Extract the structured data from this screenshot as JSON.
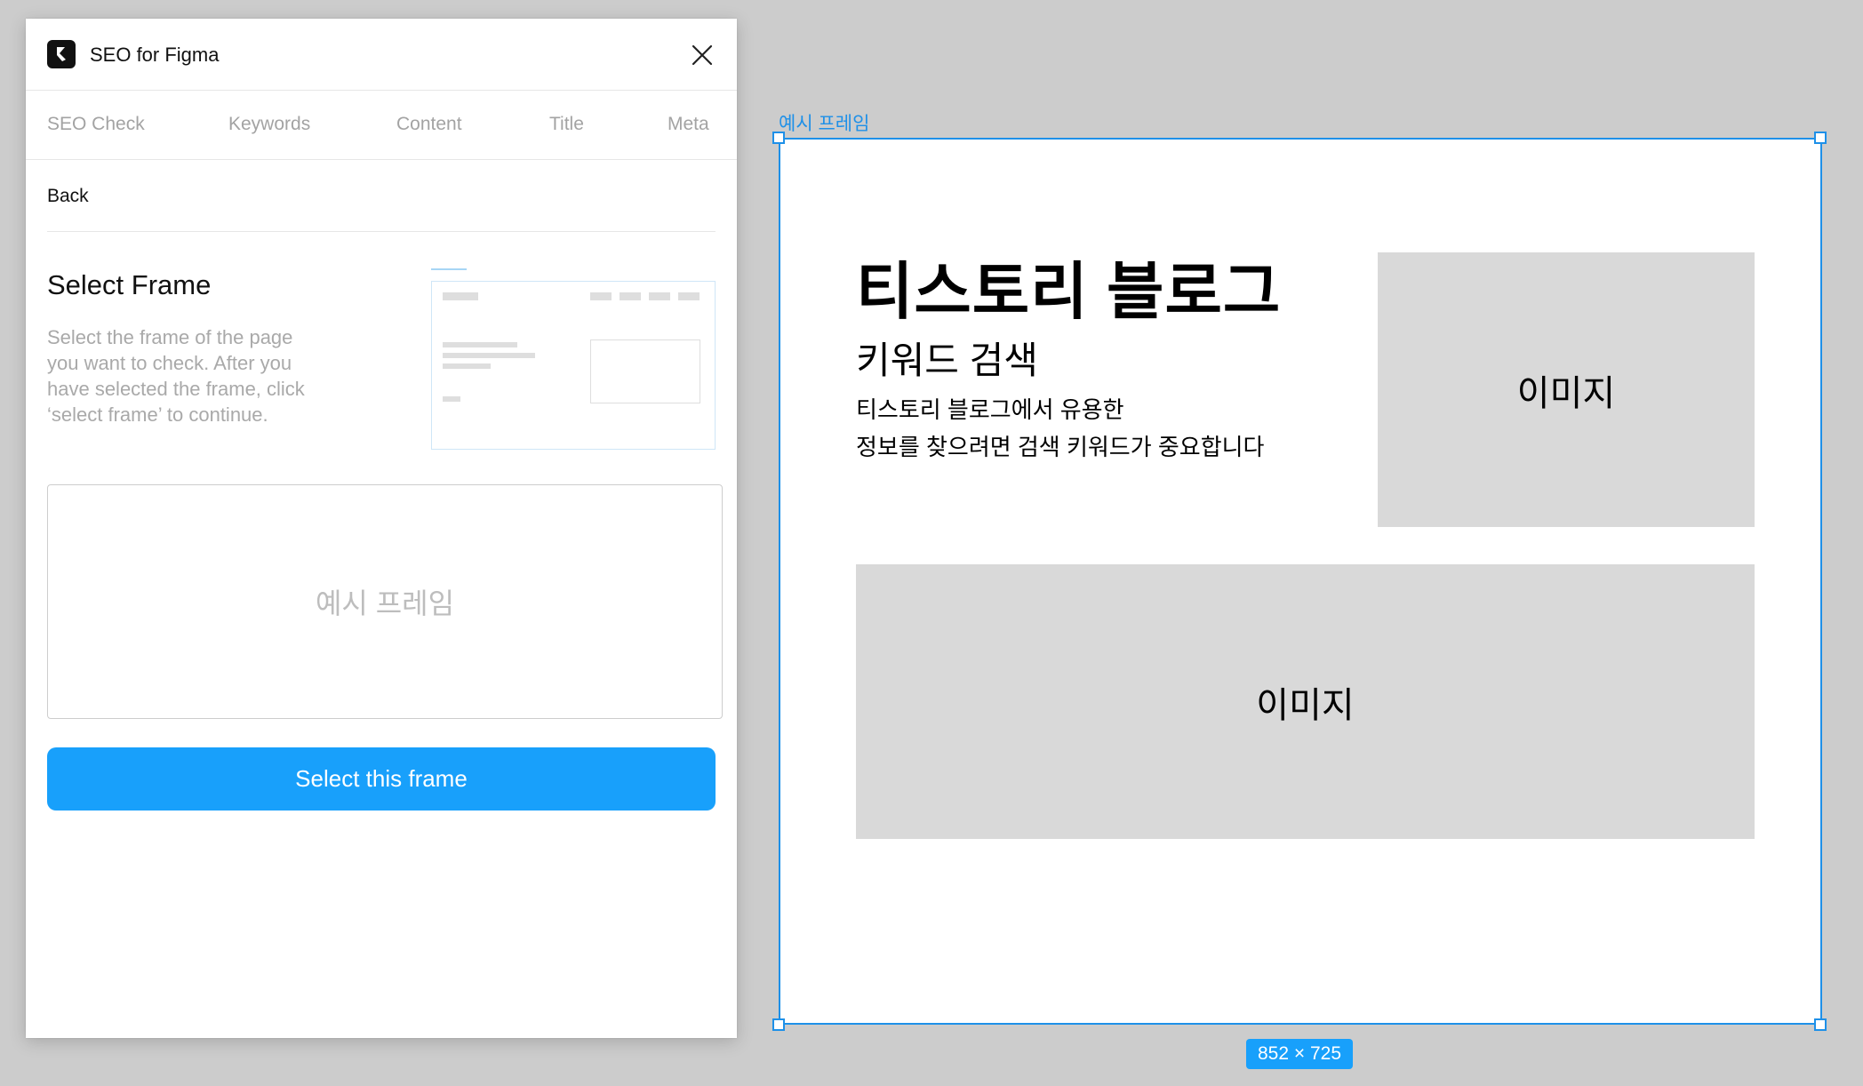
{
  "plugin": {
    "title": "SEO for Figma",
    "tabs": [
      "SEO Check",
      "Keywords",
      "Content",
      "Title",
      "Meta"
    ],
    "back_label": "Back",
    "section_title": "Select Frame",
    "section_desc_lines": [
      "Select the frame of the page",
      "you want to check. After you",
      "have selected the frame, click",
      "‘select frame’ to continue."
    ],
    "selected_frame_name": "예시 프레임",
    "primary_button_label": "Select this frame"
  },
  "canvas": {
    "frame_name": "예시 프레임",
    "size_label": "852 × 725",
    "content": {
      "title": "티스토리 블로그",
      "subtitle": "키워드 검색",
      "body_lines": [
        "티스토리 블로그에서 유용한",
        "정보를 찾으려면 검색 키워드가 중요합니다"
      ],
      "image_labels": [
        "이미지",
        "이미지"
      ]
    }
  },
  "colors": {
    "accent": "#18a0fb",
    "selection": "#1e90e8",
    "canvas_bg": "#cccccc",
    "placeholder_gray": "#d9d9d9"
  },
  "icons": {
    "app_logo": "seo-logo-icon",
    "close": "close-icon"
  }
}
